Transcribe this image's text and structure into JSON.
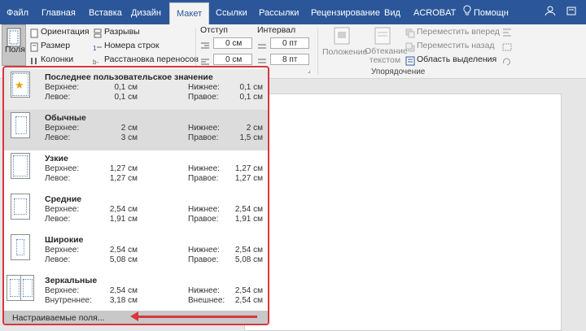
{
  "tabs": [
    {
      "label": "Файл"
    },
    {
      "label": "Главная"
    },
    {
      "label": "Вставка"
    },
    {
      "label": "Дизайн"
    },
    {
      "label": "Макет"
    },
    {
      "label": "Ссылки"
    },
    {
      "label": "Рассылки"
    },
    {
      "label": "Рецензирование"
    },
    {
      "label": "Вид"
    },
    {
      "label": "ACROBAT"
    },
    {
      "label": "Помощн"
    }
  ],
  "ribbon": {
    "fields": "Поля",
    "orientation": "Ориентация",
    "size": "Размер",
    "columns": "Колонки",
    "breaks": "Разрывы",
    "line_numbers": "Номера строк",
    "hyphenation": "Расстановка переносов",
    "indent": "Отступ",
    "spacing": "Интервал",
    "indent_left": "0 см",
    "indent_right": "0 см",
    "spacing_before": "0 пт",
    "spacing_after": "8 пт",
    "position": "Положение",
    "wrap_text": "Обтекание текстом",
    "bring_forward": "Переместить вперед",
    "send_backward": "Переместить назад",
    "selection_pane": "Область выделения",
    "arrange_group": "Упорядочение"
  },
  "margins": [
    {
      "title": "Последнее пользовательское значение",
      "l1": "Верхнее:",
      "v1": "0,1 см",
      "l2": "Нижнее:",
      "v2": "0,1 см",
      "l3": "Левое:",
      "v3": "0,1 см",
      "l4": "Правое:",
      "v4": "0,1 см"
    },
    {
      "title": "Обычные",
      "l1": "Верхнее:",
      "v1": "2 см",
      "l2": "Нижнее:",
      "v2": "2 см",
      "l3": "Левое:",
      "v3": "3 см",
      "l4": "Правое:",
      "v4": "1,5 см"
    },
    {
      "title": "Узкие",
      "l1": "Верхнее:",
      "v1": "1,27 см",
      "l2": "Нижнее:",
      "v2": "1,27 см",
      "l3": "Левое:",
      "v3": "1,27 см",
      "l4": "Правое:",
      "v4": "1,27 см"
    },
    {
      "title": "Средние",
      "l1": "Верхнее:",
      "v1": "2,54 см",
      "l2": "Нижнее:",
      "v2": "2,54 см",
      "l3": "Левое:",
      "v3": "1,91 см",
      "l4": "Правое:",
      "v4": "1,91 см"
    },
    {
      "title": "Широкие",
      "l1": "Верхнее:",
      "v1": "2,54 см",
      "l2": "Нижнее:",
      "v2": "2,54 см",
      "l3": "Левое:",
      "v3": "5,08 см",
      "l4": "Правое:",
      "v4": "5,08 см"
    },
    {
      "title": "Зеркальные",
      "l1": "Верхнее:",
      "v1": "2,54 см",
      "l2": "Нижнее:",
      "v2": "2,54 см",
      "l3": "Внутреннее:",
      "v3": "3,18 см",
      "l4": "Внешнее:",
      "v4": "2,54 см"
    }
  ],
  "custom_margins": "Настраиваемые поля...",
  "colors": {
    "accent": "#2b579a",
    "highlight": "#d9363e"
  }
}
